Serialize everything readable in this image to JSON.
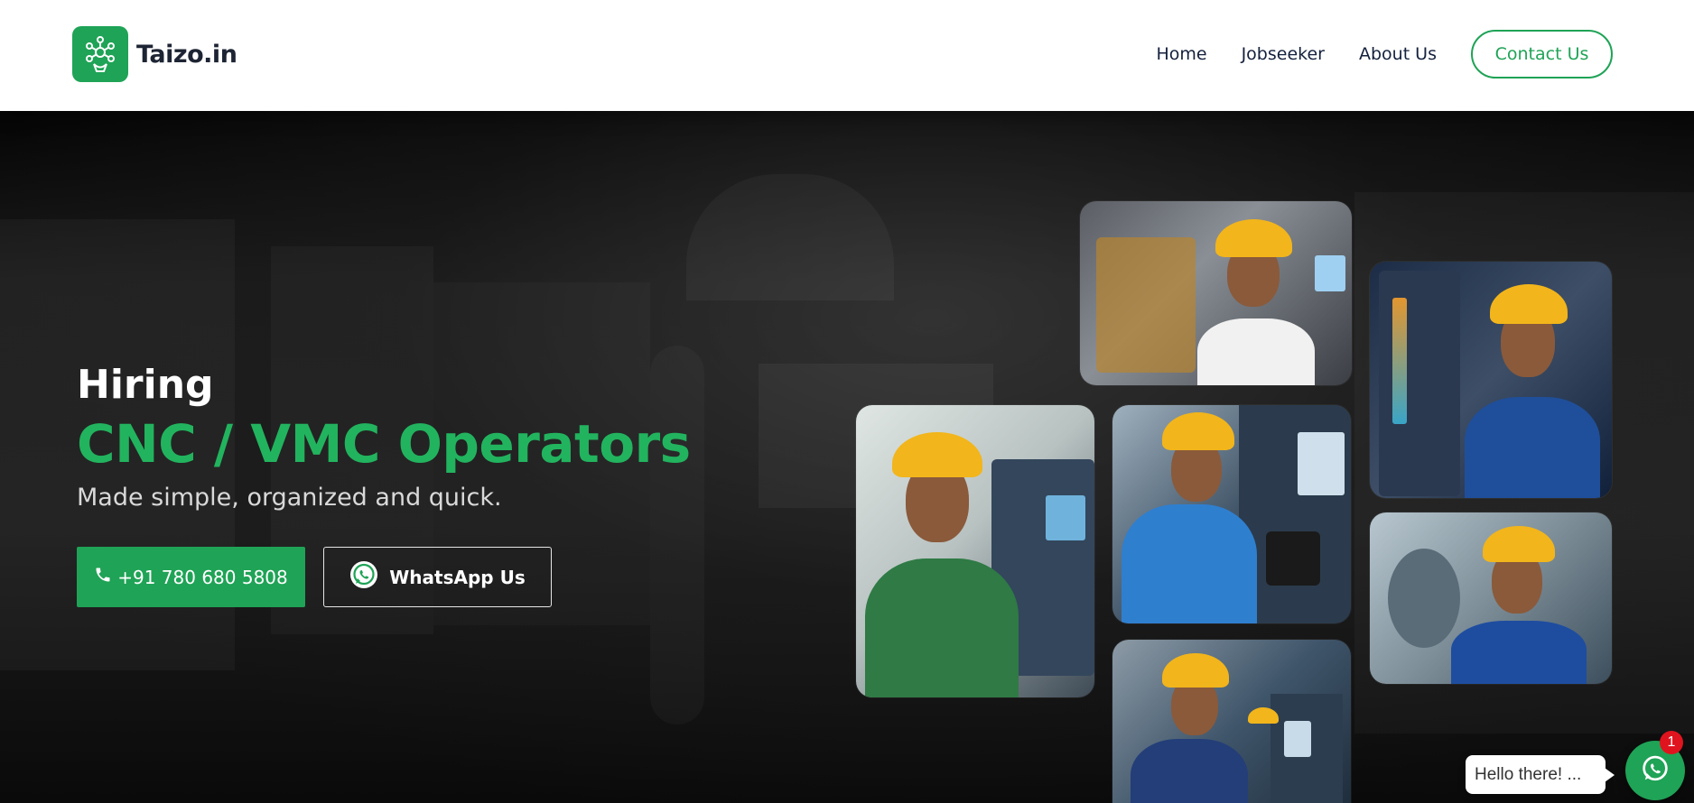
{
  "header": {
    "logo_text": "Taizo.in",
    "logo_icon": "network-hand-icon",
    "nav": [
      {
        "label": "Home"
      },
      {
        "label": "Jobseeker"
      },
      {
        "label": "About Us"
      }
    ],
    "contact_label": "Contact Us"
  },
  "hero": {
    "eyebrow": "Hiring",
    "headline": "CNC / VMC Operators",
    "tagline": "Made simple, organized and quick.",
    "phone_label": "+91 780 680 5808",
    "phone_icon": "phone-icon",
    "whatsapp_label": "WhatsApp Us",
    "whatsapp_icon": "whatsapp-icon"
  },
  "gallery": {
    "photos": [
      {
        "subject": "operator-thumbs-up-white-shirt"
      },
      {
        "subject": "operator-thumbs-up-blue-shirt"
      },
      {
        "subject": "operator-arms-crossed-green-shirt"
      },
      {
        "subject": "operator-at-control-panel"
      },
      {
        "subject": "operator-arms-crossed-blue-shirt"
      },
      {
        "subject": "operators-on-shop-floor"
      }
    ]
  },
  "chat": {
    "greeting": "Hello there! ...",
    "badge_count": "1",
    "icon": "whatsapp-icon"
  },
  "colors": {
    "brand_green": "#1fa356",
    "headline_green": "#22b35e",
    "badge_red": "#e0141e",
    "nav_text": "#14213d"
  }
}
